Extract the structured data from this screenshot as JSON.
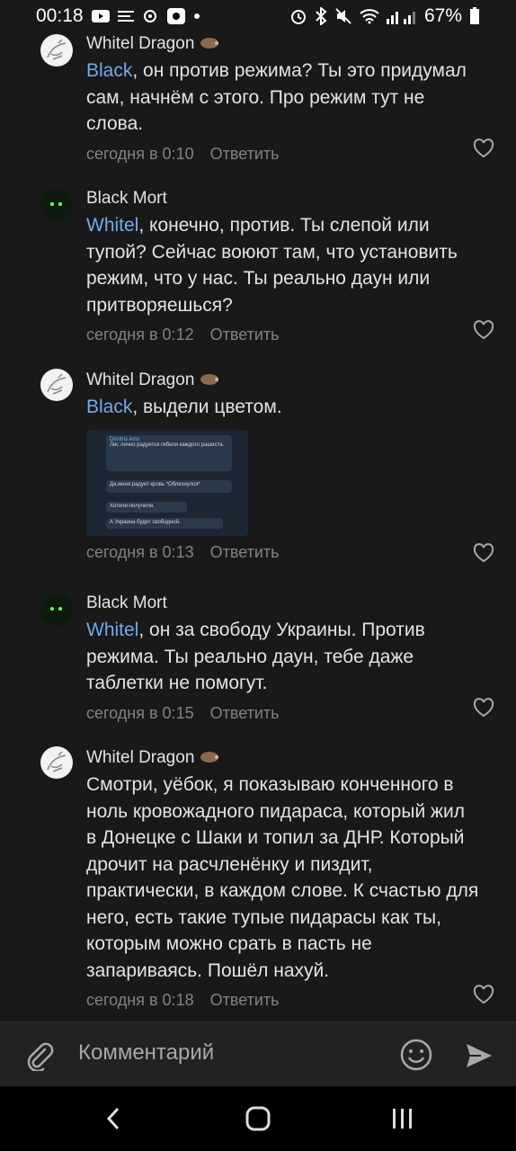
{
  "status": {
    "time": "00:18",
    "battery": "67%"
  },
  "comments": [
    {
      "author": "Whitel Dragon",
      "mention": "Black",
      "text": ", он против режима? Ты это придумал сам, начнём с этого. Про режим тут не слова.",
      "time": "сегодня в 0:10",
      "reply": "Ответить"
    },
    {
      "author": "Black Mort",
      "mention": "Whitel",
      "text": ", конечно, против. Ты слепой или тупой? Сейчас воюют там, что установить режим, что у нас. Ты реально даун или притворяешься?",
      "time": "сегодня в 0:12",
      "reply": "Ответить"
    },
    {
      "author": "Whitel Dragon",
      "mention": "Black",
      "text": ", выдели цветом.",
      "time": "сегодня в 0:13",
      "reply": "Ответить",
      "attachment": {
        "sender": "Dimitris Ams",
        "msg1": "Лис лично радуется гибели каждого рашиста.",
        "msg2": "Да,меня радует кровь *Облизнулся*",
        "msg3": "Хотели-получили.",
        "msg4": "А Украина будет свободной."
      }
    },
    {
      "author": "Black Mort",
      "mention": "Whitel",
      "text": ", он за свободу Украины. Против режима. Ты реально даун, тебе даже таблетки не помогут.",
      "time": "сегодня в 0:15",
      "reply": "Ответить"
    },
    {
      "author": "Whitel Dragon",
      "mention": "",
      "text": "Смотри, уёбок, я показываю конченного в ноль кровожадного пидараса, который жил в Донецке с Шаки и топил за ДНР. Который дрочит на расчленёнку и пиздит, практически, в каждом слове. К счастью для него, есть такие тупые пидарасы как ты, которым можно срать в пасть не запариваясь. Пошёл нахуй.",
      "time": "сегодня в 0:18",
      "reply": "Ответить"
    }
  ],
  "input": {
    "placeholder": "Комментарий"
  }
}
